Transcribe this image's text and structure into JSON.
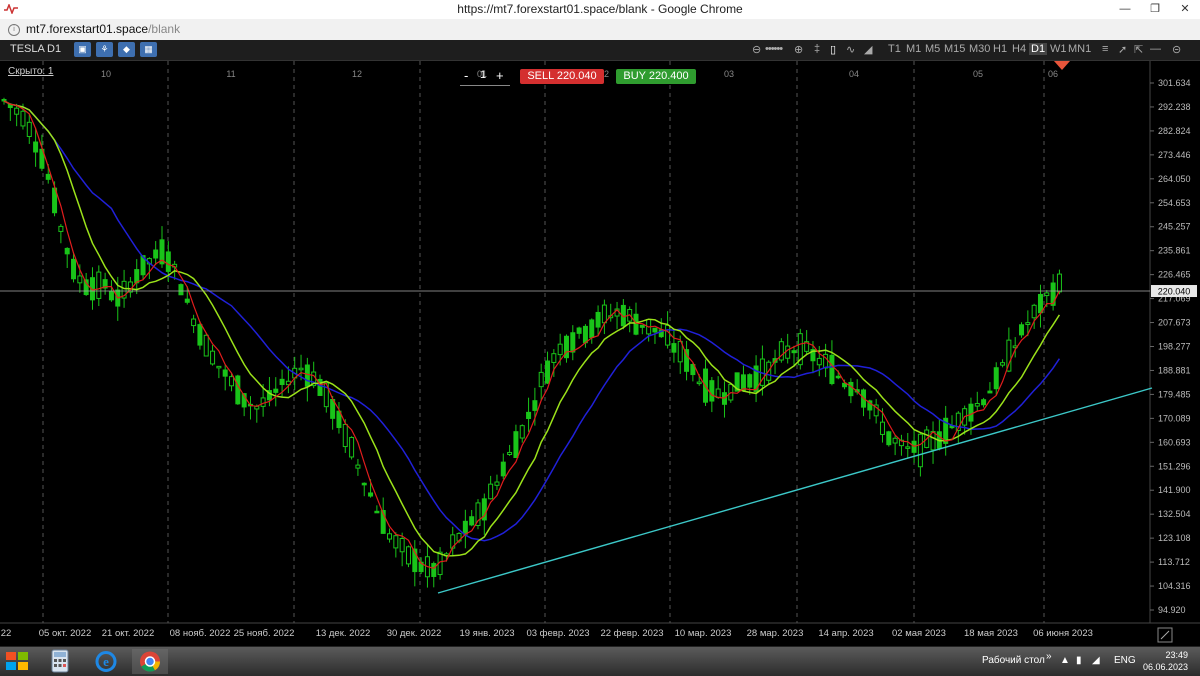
{
  "window": {
    "title": "https://mt7.forexstart01.space/blank - Google Chrome",
    "url_host": "mt7.forexstart01.space",
    "url_path": "/blank"
  },
  "toolbar": {
    "symbol": "TESLA",
    "timeframe": "D1",
    "timeframes": [
      "T1",
      "M1",
      "M5",
      "M15",
      "M30",
      "H1",
      "H4",
      "D1",
      "W1",
      "MN1"
    ],
    "active_timeframe": "D1"
  },
  "chart": {
    "hidden_label": "Скрыто: 1",
    "lot": {
      "minus": "-",
      "value": "1",
      "plus": "+"
    },
    "sell_label": "SELL 220.040",
    "buy_label": "BUY 220.400",
    "current_price": "220.040",
    "price_ticks": [
      "301.634",
      "292.238",
      "282.824",
      "273.446",
      "264.050",
      "254.653",
      "245.257",
      "235.861",
      "226.465",
      "217.069",
      "207.673",
      "198.277",
      "188.881",
      "179.485",
      "170.089",
      "160.693",
      "151.296",
      "141.900",
      "132.504",
      "123.108",
      "113.712",
      "104.316",
      "94.920"
    ],
    "date_labels": [
      "22",
      "05 окт. 2022",
      "21 окт. 2022",
      "08 нояб. 2022",
      "25 нояб. 2022",
      "13 дек. 2022",
      "30 дек. 2022",
      "19 янв. 2023",
      "03 февр. 2023",
      "22 февр. 2023",
      "10 мар. 2023",
      "28 мар. 2023",
      "14 апр. 2023",
      "02 мая 2023",
      "18 мая 2023",
      "06 июня 2023"
    ],
    "month_labels": [
      "10",
      "11",
      "12",
      "01",
      "02",
      "03",
      "04",
      "05",
      "06"
    ],
    "colors": {
      "bull": "#19c419",
      "ma_fast": "#e11d1d",
      "ma_mid": "#9be21a",
      "ma_slow": "#2020d8",
      "trend": "#3cc8c8",
      "sell": "#d42f2f",
      "buy": "#2f9c2f"
    }
  },
  "taskbar": {
    "desktop_label": "Рабочий стол",
    "lang": "ENG",
    "time": "23:49",
    "date": "06.06.2023"
  }
}
